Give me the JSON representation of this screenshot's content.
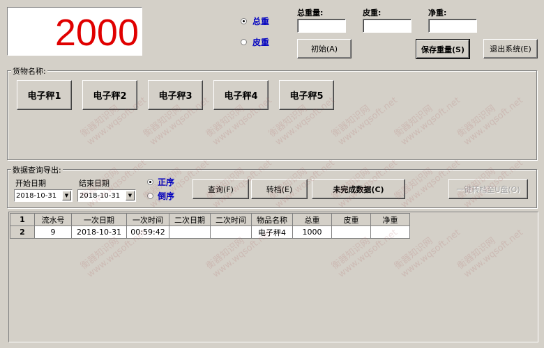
{
  "display": {
    "weight": "2000"
  },
  "mode": {
    "gross_label": "总重",
    "tare_label": "皮重",
    "selected": "gross"
  },
  "fields": {
    "gross_label": "总重量:",
    "tare_label": "皮重:",
    "net_label": "净重:",
    "gross_value": "",
    "tare_value": "",
    "net_value": ""
  },
  "buttons": {
    "init": "初始(A)",
    "save": "保存重量(S)",
    "exit": "退出系统(E)",
    "query": "查询(F)",
    "archive": "转档(E)",
    "incomplete": "未完成数据(C)",
    "export_usb": "一键转档至U盘(O)"
  },
  "goods": {
    "title": "货物名称:",
    "items": [
      "电子秤1",
      "电子秤2",
      "电子秤3",
      "电子秤4",
      "电子秤5"
    ]
  },
  "query": {
    "title": "数据查询导出:",
    "start_label": "开始日期",
    "end_label": "结束日期",
    "start_date": "2018-10-31",
    "end_date": "2018-10-31",
    "order_asc": "正序",
    "order_desc": "倒序",
    "order_selected": "asc"
  },
  "table": {
    "row_numbers": [
      "1",
      "2"
    ],
    "headers": [
      "流水号",
      "一次日期",
      "一次时间",
      "二次日期",
      "二次时间",
      "物品名称",
      "总重",
      "皮重",
      "净重"
    ],
    "rows": [
      [
        "9",
        "2018-10-31",
        "00:59:42",
        "",
        "",
        "电子秤4",
        "1000",
        "",
        ""
      ]
    ]
  },
  "watermark": [
    "衡器知识网",
    "www.wqsoft.net"
  ]
}
